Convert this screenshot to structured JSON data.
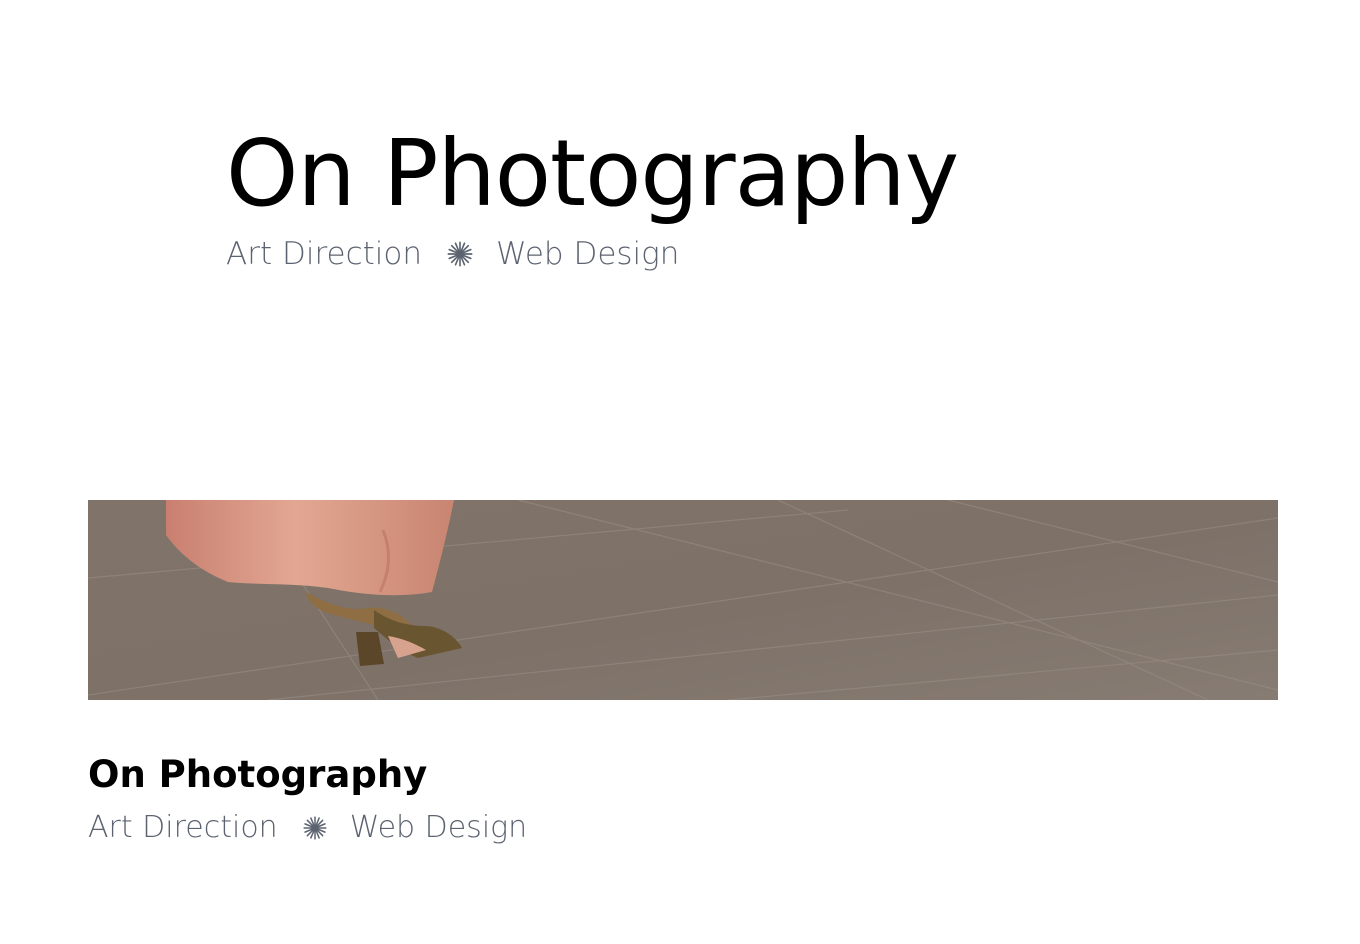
{
  "hero": {
    "title": "On Photography",
    "categories": [
      "Art Direction",
      "Web Design"
    ]
  },
  "card": {
    "title": "On Photography",
    "categories": [
      "Art Direction",
      "Web Design"
    ]
  },
  "icons": {
    "separator": "starburst-icon"
  },
  "colors": {
    "text": "#000000",
    "muted": "#5c6370",
    "floor": "#7f746b",
    "dress": "#d79a84",
    "shoe": "#6a5531"
  }
}
